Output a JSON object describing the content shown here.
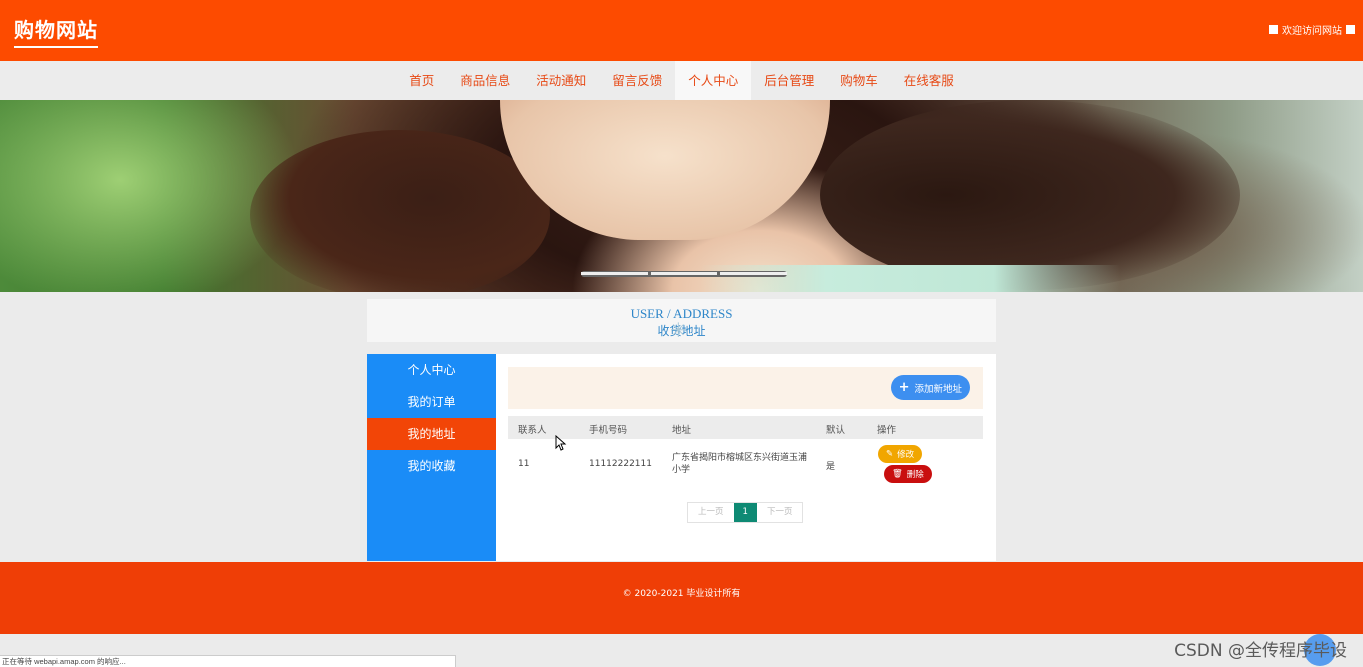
{
  "header": {
    "logo": "购物网站",
    "welcome": "欢迎访问网站"
  },
  "nav": [
    "首页",
    "商品信息",
    "活动通知",
    "留言反馈",
    "个人中心",
    "后台管理",
    "购物车",
    "在线客服"
  ],
  "nav_active": "个人中心",
  "section_title": {
    "en": "USER / ADDRESS",
    "cn": "收货地址"
  },
  "sidebar": [
    "个人中心",
    "我的订单",
    "我的地址",
    "我的收藏"
  ],
  "sidebar_active": "我的地址",
  "toolbar": {
    "add_label": "添加新地址"
  },
  "table": {
    "headers": [
      "联系人",
      "手机号码",
      "地址",
      "默认",
      "操作"
    ],
    "rows": [
      {
        "contact": "11",
        "phone": "11112222111",
        "address_line1": "广东省揭阳市榕城区东兴街道玉浦",
        "address_line2": "小学",
        "default": "是",
        "edit": "修改",
        "delete": "删除"
      }
    ]
  },
  "pager": {
    "prev": "上一页",
    "current": "1",
    "next": "下一页"
  },
  "footer": {
    "copyright": "© 2020-2021 毕业设计所有"
  },
  "statusbar": "正在等待 webapi.amap.com 的响应...",
  "watermark": "CSDN @全传程序毕设"
}
